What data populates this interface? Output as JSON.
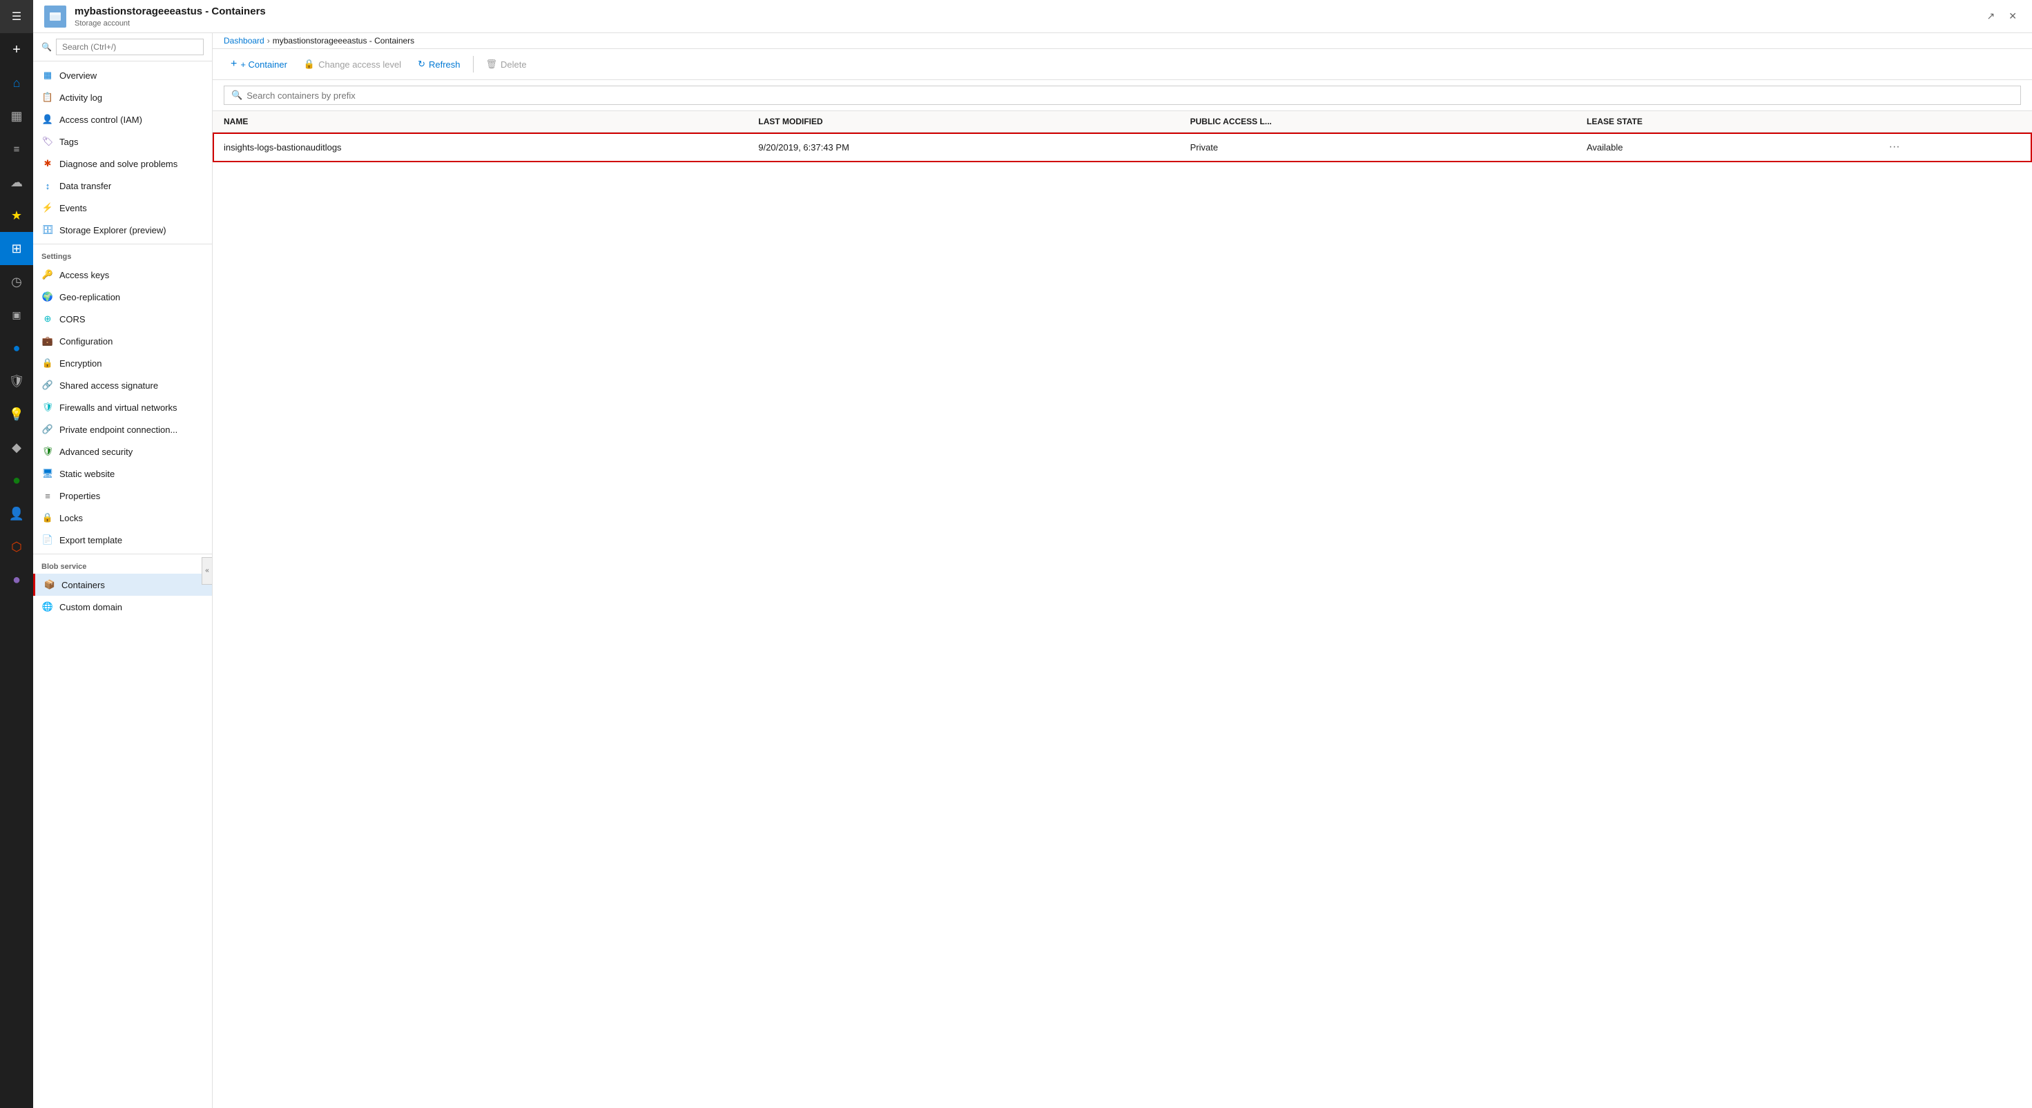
{
  "window": {
    "title": "mybastionstorageeeastus - Containers",
    "subtitle": "Storage account",
    "breadcrumb_home": "Dashboard",
    "breadcrumb_current": "mybastionstorageeeastus - Containers"
  },
  "toolbar": {
    "add_container_label": "+ Container",
    "change_access_label": "Change access level",
    "refresh_label": "Refresh",
    "delete_label": "Delete"
  },
  "search": {
    "placeholder": "Search containers by prefix"
  },
  "sidebar_search": {
    "placeholder": "Search (Ctrl+/)"
  },
  "table": {
    "col_name": "NAME",
    "col_last_modified": "LAST MODIFIED",
    "col_public_access": "PUBLIC ACCESS L...",
    "col_lease_state": "LEASE STATE"
  },
  "containers": [
    {
      "name": "insights-logs-bastionauditlogs",
      "last_modified": "9/20/2019, 6:37:43 PM",
      "public_access": "Private",
      "lease_state": "Available"
    }
  ],
  "nav": {
    "items": [
      {
        "id": "overview",
        "label": "Overview",
        "icon": "grid"
      },
      {
        "id": "activity-log",
        "label": "Activity log",
        "icon": "activity"
      },
      {
        "id": "access-control",
        "label": "Access control (IAM)",
        "icon": "person-shield"
      },
      {
        "id": "tags",
        "label": "Tags",
        "icon": "tag"
      },
      {
        "id": "diagnose",
        "label": "Diagnose and solve problems",
        "icon": "wrench"
      },
      {
        "id": "data-transfer",
        "label": "Data transfer",
        "icon": "arrows"
      },
      {
        "id": "events",
        "label": "Events",
        "icon": "flash"
      },
      {
        "id": "storage-explorer",
        "label": "Storage Explorer (preview)",
        "icon": "storage"
      }
    ],
    "settings_section": "Settings",
    "settings_items": [
      {
        "id": "access-keys",
        "label": "Access keys",
        "icon": "key"
      },
      {
        "id": "geo-replication",
        "label": "Geo-replication",
        "icon": "globe"
      },
      {
        "id": "cors",
        "label": "CORS",
        "icon": "cors"
      },
      {
        "id": "configuration",
        "label": "Configuration",
        "icon": "briefcase"
      },
      {
        "id": "encryption",
        "label": "Encryption",
        "icon": "lock"
      },
      {
        "id": "shared-access",
        "label": "Shared access signature",
        "icon": "link"
      },
      {
        "id": "firewalls",
        "label": "Firewalls and virtual networks",
        "icon": "shield"
      },
      {
        "id": "private-endpoint",
        "label": "Private endpoint connection...",
        "icon": "link2"
      },
      {
        "id": "advanced-security",
        "label": "Advanced security",
        "icon": "shield2"
      },
      {
        "id": "static-website",
        "label": "Static website",
        "icon": "webpage"
      },
      {
        "id": "properties",
        "label": "Properties",
        "icon": "bars"
      },
      {
        "id": "locks",
        "label": "Locks",
        "icon": "padlock"
      },
      {
        "id": "export-template",
        "label": "Export template",
        "icon": "export"
      }
    ],
    "blob_section": "Blob service",
    "blob_items": [
      {
        "id": "containers",
        "label": "Containers",
        "icon": "container",
        "active": true
      },
      {
        "id": "custom-domain",
        "label": "Custom domain",
        "icon": "webpage2"
      }
    ]
  },
  "rail_icons": [
    {
      "id": "menu",
      "symbol": "☰",
      "active": false
    },
    {
      "id": "plus",
      "symbol": "+",
      "active": false
    },
    {
      "id": "home",
      "symbol": "⌂",
      "active": false
    },
    {
      "id": "dashboard",
      "symbol": "▦",
      "active": false
    },
    {
      "id": "notifications",
      "symbol": "≡",
      "active": false
    },
    {
      "id": "cloud",
      "symbol": "☁",
      "active": false
    },
    {
      "id": "star",
      "symbol": "★",
      "active": false
    },
    {
      "id": "apps",
      "symbol": "⊞",
      "active": false
    },
    {
      "id": "clock",
      "symbol": "◷",
      "active": false
    },
    {
      "id": "monitor",
      "symbol": "▣",
      "active": false
    },
    {
      "id": "circle-blue",
      "symbol": "●",
      "active": true
    },
    {
      "id": "shield-rail",
      "symbol": "⛉",
      "active": false
    },
    {
      "id": "bulb",
      "symbol": "💡",
      "active": false
    },
    {
      "id": "diamond",
      "symbol": "◆",
      "active": false
    },
    {
      "id": "circle2",
      "symbol": "○",
      "active": false
    },
    {
      "id": "person",
      "symbol": "👤",
      "active": false
    },
    {
      "id": "puzzle",
      "symbol": "⬡",
      "active": false
    },
    {
      "id": "circle3",
      "symbol": "●",
      "active": false
    }
  ]
}
